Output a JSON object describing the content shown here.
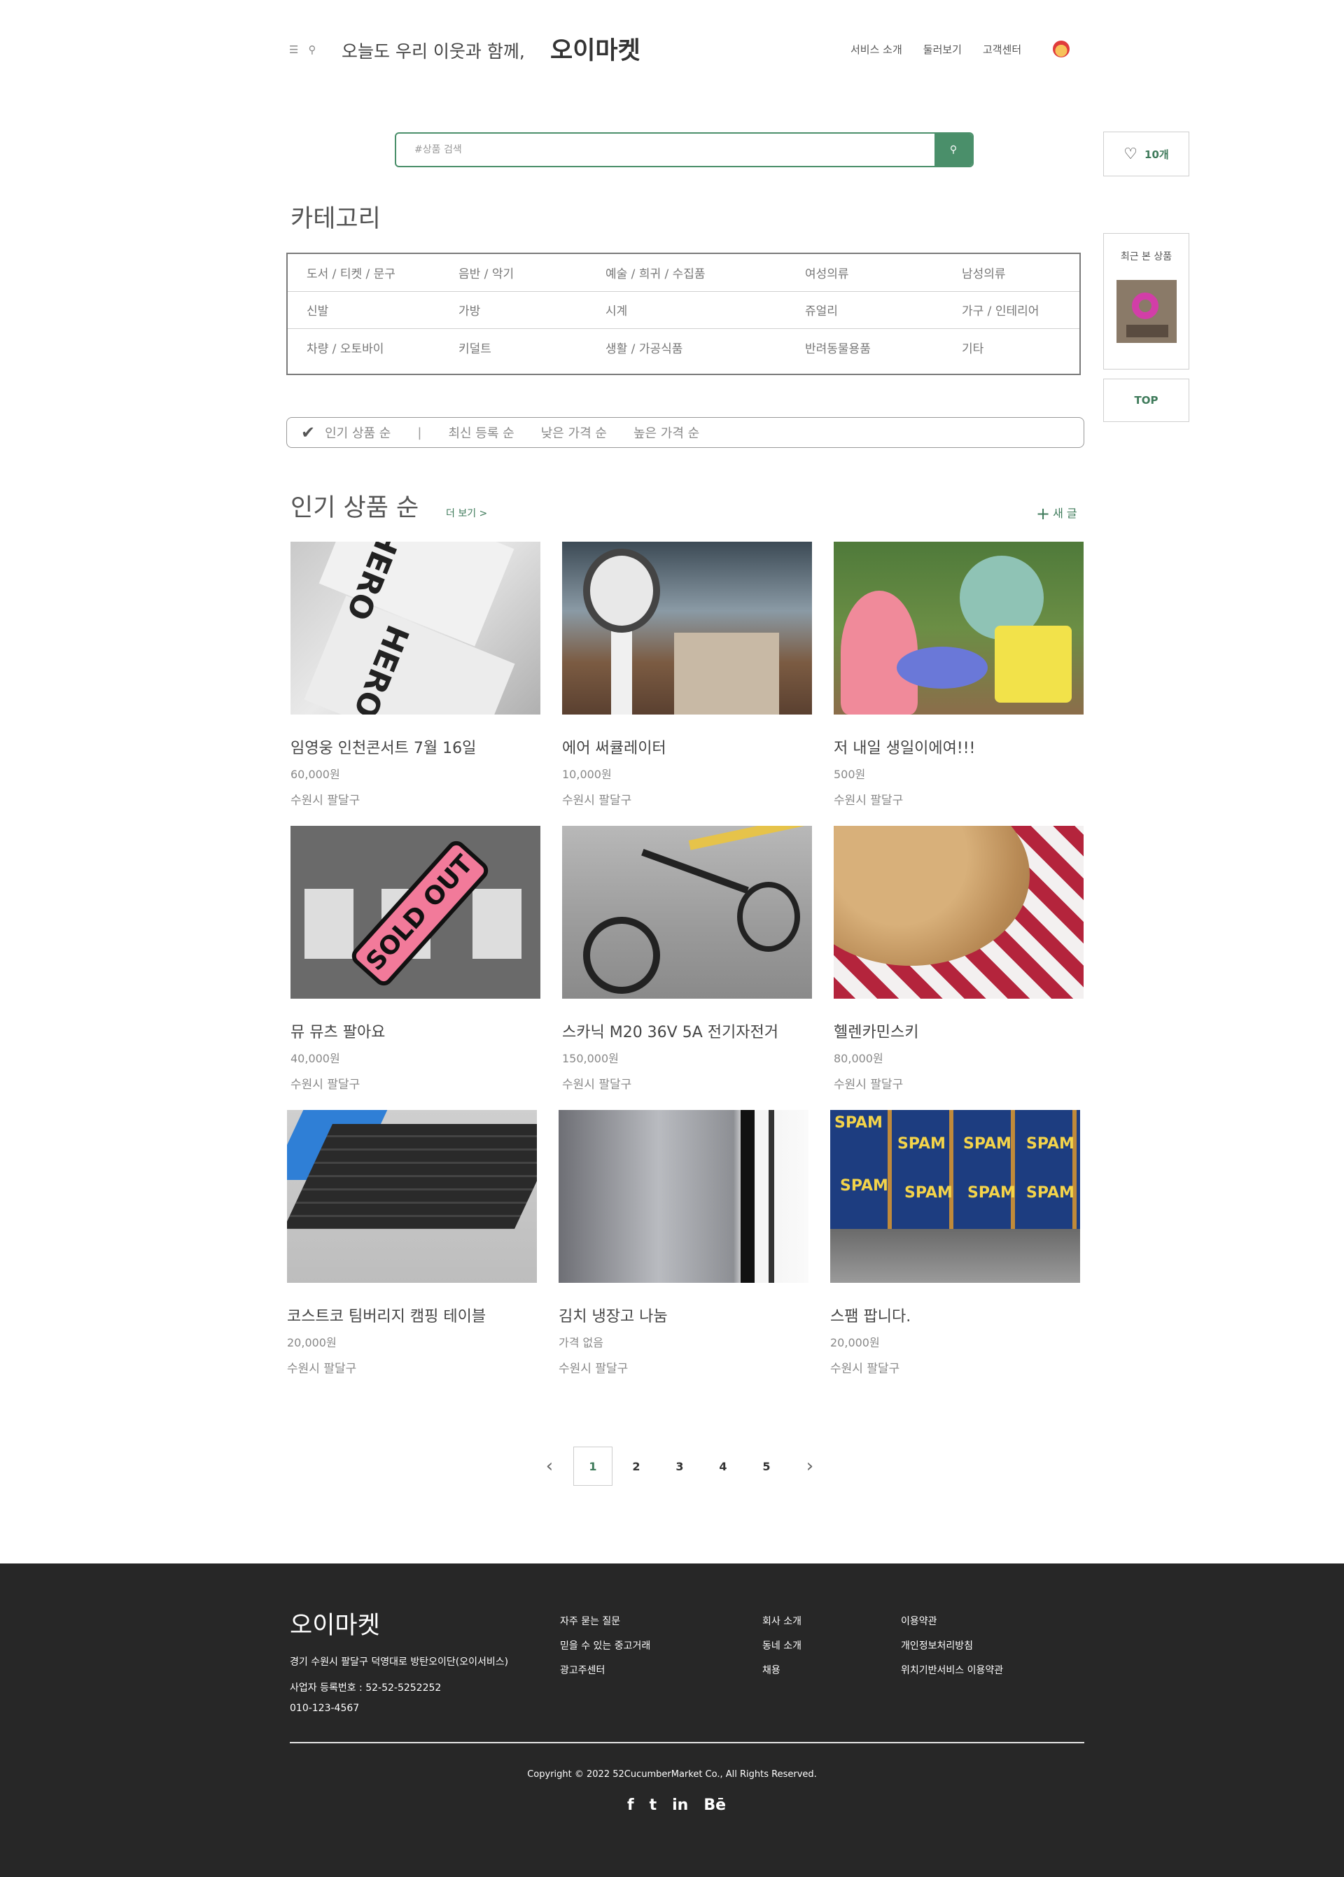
{
  "header": {
    "menu_icon": "hamburger-icon",
    "search_icon": "search-icon",
    "tagline": "오늘도 우리 이웃과 함께,",
    "logo": "오이마켓",
    "nav": [
      "서비스 소개",
      "둘러보기",
      "고객센터"
    ],
    "avatar_icon": "profile-avatar"
  },
  "search": {
    "placeholder": "#상품 검색",
    "button_icon": "search-icon"
  },
  "sidebar": {
    "likes": "10개",
    "recent_title": "최근 본 상품",
    "top": "TOP"
  },
  "category": {
    "title": "카테고리",
    "rows": [
      [
        "도서 / 티켓 / 문구",
        "음반 / 악기",
        "예술 / 희귀 / 수집품",
        "여성의류",
        "남성의류"
      ],
      [
        "신발",
        "가방",
        "시계",
        "쥬얼리",
        "가구 / 인테리어"
      ],
      [
        "차량 / 오토바이",
        "키덜트",
        "생활 / 가공식품",
        "반려동물용품",
        "기타"
      ]
    ]
  },
  "sort": {
    "options": [
      "인기 상품 순",
      "최신 등록 순",
      "낮은 가격 순",
      "높은 가격 순"
    ],
    "separator": "|"
  },
  "section": {
    "title": "인기 상품 순",
    "more": "더 보기 >",
    "new_post": "새 글"
  },
  "products": [
    {
      "name": "임영웅 인천콘서트 7월 16일",
      "price": "60,000원",
      "location": "수원시 팔달구"
    },
    {
      "name": "에어 써큘레이터",
      "price": "10,000원",
      "location": "수원시 팔달구"
    },
    {
      "name": "저 내일 생일이에여!!!",
      "price": "500원",
      "location": "수원시 팔달구"
    },
    {
      "name": "뮤 뮤츠 팔아요",
      "price": "40,000원",
      "location": "수원시 팔달구"
    },
    {
      "name": "스카닉 M20  36V 5A 전기자전거",
      "price": "150,000원",
      "location": "수원시 팔달구"
    },
    {
      "name": "헬렌카민스키",
      "price": "80,000원",
      "location": "수원시 팔달구"
    },
    {
      "name": "코스트코 팀버리지 캠핑 테이블",
      "price": "20,000원",
      "location": "수원시 팔달구"
    },
    {
      "name": "김치 냉장고 나눔",
      "price": "가격 없음",
      "location": "수원시 팔달구"
    },
    {
      "name": "스팸 팝니다.",
      "price": "20,000원",
      "location": "수원시 팔달구"
    }
  ],
  "image_text": {
    "hero": "HERO",
    "sold_out": "SOLD OUT",
    "spam": "SPAM"
  },
  "pagination": {
    "prev": "‹",
    "pages": [
      "1",
      "2",
      "3",
      "4",
      "5"
    ],
    "current": "1",
    "next": "›"
  },
  "footer": {
    "logo": "오이마켓",
    "address": "경기 수원시 팔달구 덕영대로 방탄오이단(오이서비스)",
    "biz_no": "사업자 등록번호 : 52-52-5252252",
    "phone": "010-123-4567",
    "col1": [
      "자주 묻는 질문",
      "믿을 수 있는 중고거래",
      "광고주센터"
    ],
    "col2": [
      "회사 소개",
      "동네 소개",
      "채용"
    ],
    "col3": [
      "이용약관",
      "개인정보처리방침",
      "위치기반서비스 이용약관"
    ],
    "copyright": "Copyright © 2022 52CucumberMarket Co., All Rights Reserved.",
    "social": [
      "f",
      "t",
      "in",
      "Bē"
    ]
  },
  "colors": {
    "accent": "#4a8f6a",
    "accent_text": "#3e7a5a",
    "footer_bg": "#272727"
  }
}
